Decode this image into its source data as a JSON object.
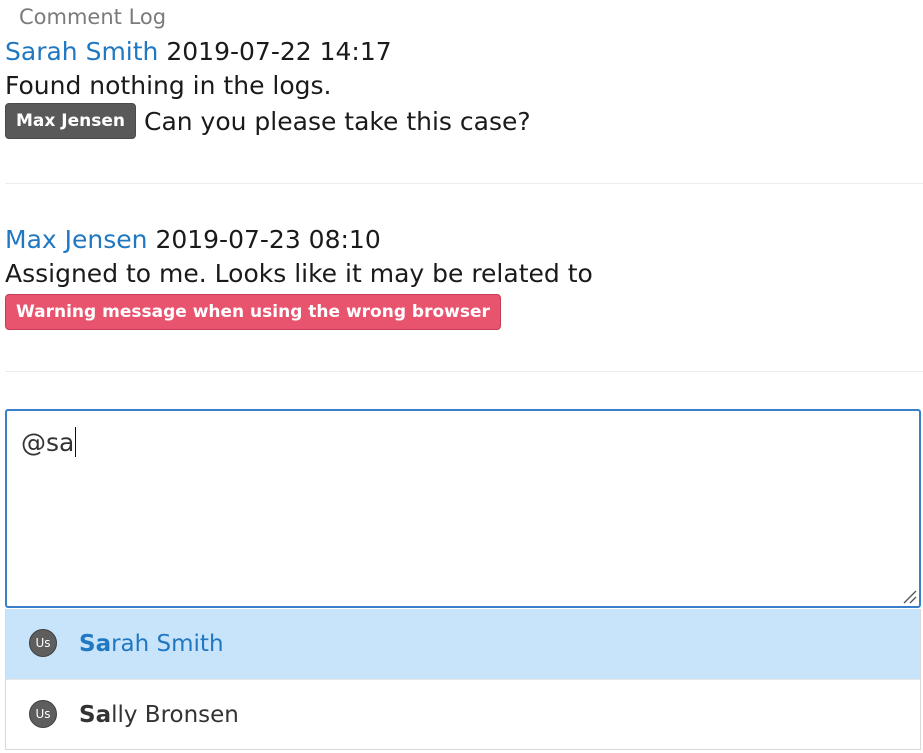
{
  "log_title": "Comment Log",
  "comments": [
    {
      "author": "Sarah Smith",
      "timestamp": "2019-07-22 14:17",
      "line1": "Found nothing in the logs.",
      "mention": "Max Jensen",
      "line2": "Can you please take this case?"
    },
    {
      "author": "Max Jensen",
      "timestamp": "2019-07-23 08:10",
      "line1": "Assigned to me. Looks like it may be related to",
      "ticket": "Warning message when using the wrong browser"
    }
  ],
  "composer": {
    "value": "@sa"
  },
  "suggestions": [
    {
      "avatar": "Us",
      "match": "Sa",
      "rest": "rah Smith",
      "highlighted": true
    },
    {
      "avatar": "Us",
      "match": "Sa",
      "rest": "lly Bronsen",
      "highlighted": false
    }
  ],
  "colors": {
    "link": "#1f78c1",
    "user_tag": "#595959",
    "ticket_tag": "#e8536e",
    "focus_border": "#3a7fc9",
    "highlight_row": "#c8e4fb"
  }
}
